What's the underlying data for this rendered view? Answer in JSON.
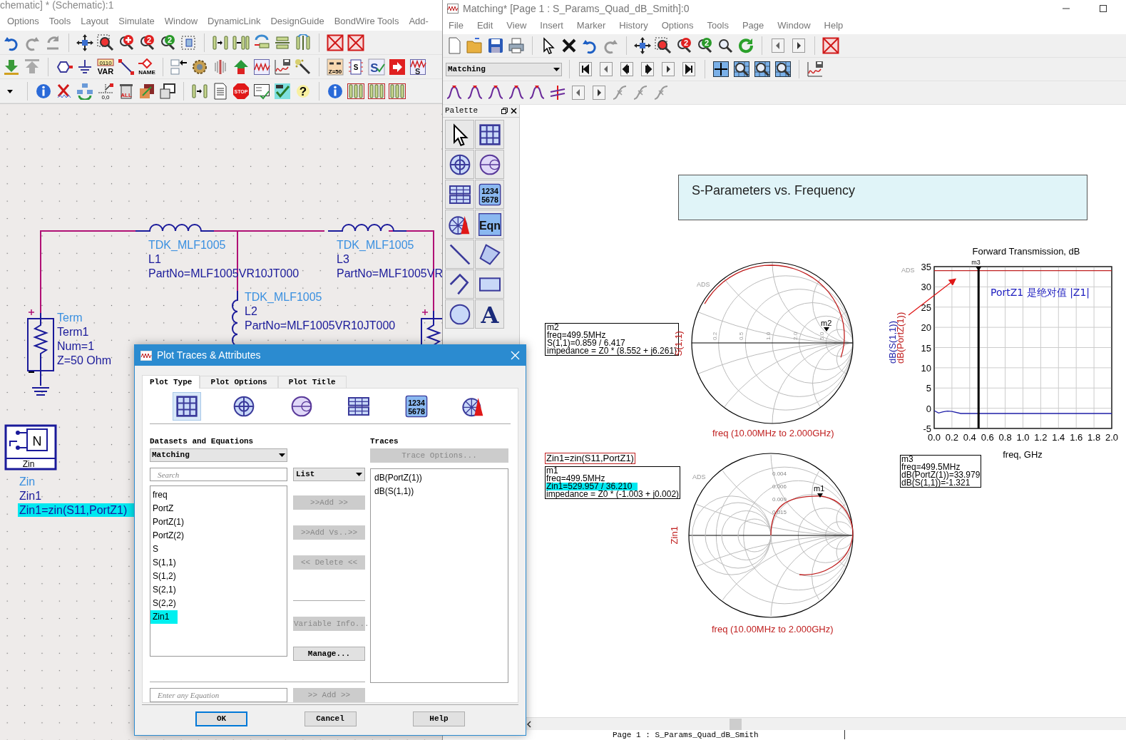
{
  "schematic_window": {
    "title": "chematic] * (Schematic):1",
    "menu": [
      "Options",
      "Tools",
      "Layout",
      "Simulate",
      "Window",
      "DynamicLink",
      "DesignGuide",
      "BondWire Tools",
      "Add-"
    ],
    "toolbars": [
      [
        {
          "kind": "undo"
        },
        {
          "kind": "redo"
        },
        {
          "kind": "rotate"
        },
        {
          "kind": "sep"
        },
        {
          "kind": "move"
        },
        {
          "kind": "zoom-area"
        },
        {
          "kind": "zoom-plus"
        },
        {
          "kind": "zoom-red",
          "label": "2"
        },
        {
          "kind": "zoom-green",
          "label": "2"
        },
        {
          "kind": "snap"
        },
        {
          "kind": "sep"
        },
        {
          "kind": "comp-step"
        },
        {
          "kind": "comp-pair"
        },
        {
          "kind": "swap"
        },
        {
          "kind": "flip"
        },
        {
          "kind": "mirror"
        },
        {
          "kind": "sep"
        },
        {
          "kind": "x-box"
        },
        {
          "kind": "x-box"
        }
      ],
      [
        {
          "kind": "down"
        },
        {
          "kind": "up"
        },
        {
          "kind": "sep"
        },
        {
          "kind": "port"
        },
        {
          "kind": "ground"
        },
        {
          "kind": "var",
          "top_label": "0110",
          "label": "VAR"
        },
        {
          "kind": "wire"
        },
        {
          "kind": "name",
          "label": "NAME"
        },
        {
          "kind": "sep"
        },
        {
          "kind": "sim-in"
        },
        {
          "kind": "gear"
        },
        {
          "kind": "probe"
        },
        {
          "kind": "arrow-up"
        },
        {
          "kind": "chart"
        },
        {
          "kind": "chart-save"
        },
        {
          "kind": "wand"
        },
        {
          "kind": "sep"
        },
        {
          "kind": "z50",
          "label": "Z=50"
        },
        {
          "kind": "s-box",
          "label": "S"
        },
        {
          "kind": "s-check",
          "label": "S"
        },
        {
          "kind": "arrow-box"
        },
        {
          "kind": "s-chart",
          "label": "S"
        }
      ],
      [
        {
          "kind": "caret"
        },
        {
          "kind": "sep"
        },
        {
          "kind": "info"
        },
        {
          "kind": "x-wave"
        },
        {
          "kind": "tree"
        },
        {
          "kind": "origin",
          "label": "0,0"
        },
        {
          "kind": "trash",
          "label": "ALL"
        },
        {
          "kind": "layers"
        },
        {
          "kind": "windows"
        },
        {
          "kind": "sep"
        },
        {
          "kind": "comp-step"
        },
        {
          "kind": "doc"
        },
        {
          "kind": "stop",
          "label": "STOP"
        },
        {
          "kind": "checklist"
        },
        {
          "kind": "check-db"
        },
        {
          "kind": "help",
          "label": "?"
        },
        {
          "kind": "sep"
        },
        {
          "kind": "info"
        },
        {
          "kind": "comp-3"
        },
        {
          "kind": "comp-3"
        },
        {
          "kind": "comp-3"
        }
      ]
    ],
    "components": [
      {
        "kind": "inductor-h",
        "lines": [
          {
            "kind": "model",
            "text": "TDK_MLF1005"
          },
          {
            "kind": "name",
            "text": "L1"
          },
          {
            "kind": "param",
            "text": "PartNo=MLF1005VR10JT000"
          }
        ]
      },
      {
        "kind": "inductor-h",
        "lines": [
          {
            "kind": "model",
            "text": "TDK_MLF1005"
          },
          {
            "kind": "name",
            "text": "L3"
          },
          {
            "kind": "param",
            "text": "PartNo=MLF1005VR"
          }
        ]
      },
      {
        "kind": "inductor-v",
        "lines": [
          {
            "kind": "model",
            "text": "TDK_MLF1005"
          },
          {
            "kind": "name",
            "text": "L2"
          },
          {
            "kind": "param",
            "text": "PartNo=MLF1005VR10JT000"
          }
        ]
      },
      {
        "kind": "term",
        "lines": [
          {
            "kind": "model",
            "text": "Term"
          },
          {
            "kind": "name",
            "text": "Term1"
          },
          {
            "kind": "param",
            "text": "Num=1"
          },
          {
            "kind": "param",
            "text": "Z=50 Ohm"
          }
        ]
      },
      {
        "kind": "term-partial"
      },
      {
        "kind": "zin",
        "symbol_letter": "N",
        "symbol_label": "Zin",
        "lines": [
          {
            "kind": "model",
            "text": "Zin"
          },
          {
            "kind": "name",
            "text": "Zin1"
          },
          {
            "kind": "equation",
            "text": "Zin1=zin(S11,PortZ1)"
          }
        ]
      }
    ]
  },
  "display_window": {
    "title": "Matching* [Page 1 : S_Params_Quad_dB_Smith]:0",
    "menu": [
      "File",
      "Edit",
      "View",
      "Insert",
      "Marker",
      "History",
      "Options",
      "Tools",
      "Page",
      "Window",
      "Help"
    ],
    "toolbars": [
      [
        {
          "kind": "new"
        },
        {
          "kind": "open"
        },
        {
          "kind": "save"
        },
        {
          "kind": "print"
        },
        {
          "kind": "sep"
        },
        {
          "kind": "pointer"
        },
        {
          "kind": "delete"
        },
        {
          "kind": "undo"
        },
        {
          "kind": "redo"
        },
        {
          "kind": "sep"
        },
        {
          "kind": "move"
        },
        {
          "kind": "zoom-area"
        },
        {
          "kind": "zoom-red",
          "label": "2"
        },
        {
          "kind": "zoom-green",
          "label": "2"
        },
        {
          "kind": "zoom"
        },
        {
          "kind": "refresh"
        },
        {
          "kind": "sep"
        },
        {
          "kind": "nav-prev"
        },
        {
          "kind": "nav-next"
        },
        {
          "kind": "sep"
        },
        {
          "kind": "x-box"
        }
      ],
      [
        {
          "kind": "dropdown",
          "label": "Matching"
        },
        {
          "kind": "sep"
        },
        {
          "kind": "nav-first"
        },
        {
          "kind": "nav-prev"
        },
        {
          "kind": "step-back"
        },
        {
          "kind": "step-fwd"
        },
        {
          "kind": "nav-next"
        },
        {
          "kind": "nav-last"
        },
        {
          "kind": "sep"
        },
        {
          "kind": "fit-grid"
        },
        {
          "kind": "zoom-grid"
        },
        {
          "kind": "zoom-grid"
        },
        {
          "kind": "zoom-grid"
        },
        {
          "kind": "sep"
        },
        {
          "kind": "chart-save"
        }
      ],
      [
        {
          "kind": "marker"
        },
        {
          "kind": "marker"
        },
        {
          "kind": "marker"
        },
        {
          "kind": "marker"
        },
        {
          "kind": "marker"
        },
        {
          "kind": "delta"
        },
        {
          "kind": "nav-prev"
        },
        {
          "kind": "nav-next"
        },
        {
          "kind": "trace"
        },
        {
          "kind": "trace"
        },
        {
          "kind": "trace"
        }
      ]
    ],
    "palette": {
      "title": "Palette",
      "tools": [
        {
          "kind": "pointer"
        },
        {
          "kind": "grid"
        },
        {
          "kind": "polar"
        },
        {
          "kind": "smith"
        },
        {
          "kind": "table"
        },
        {
          "kind": "numbers",
          "label": "1234 5678"
        },
        {
          "kind": "polar-antenna"
        },
        {
          "kind": "eqn",
          "label": "Eqn"
        },
        {
          "kind": "line"
        },
        {
          "kind": "polygon"
        },
        {
          "kind": "polyline"
        },
        {
          "kind": "rect"
        },
        {
          "kind": "circle"
        },
        {
          "kind": "text-a",
          "label": "A"
        }
      ]
    },
    "page_title": "S-Parameters vs. Frequency",
    "smith_top": {
      "logo": "ADS",
      "axis_label": "S(1,1)",
      "freq_label": "freq (10.00MHz to 2.000GHz)",
      "scale_labels": [
        "0.2",
        "0.5",
        "1.0",
        "2.0",
        "5.0"
      ],
      "marker": "m2",
      "marker_box": [
        "m2",
        "freq=499.5MHz",
        "S(1,1)=0.859 / 6.417",
        "impedance = Z0 * (8.552 + j6.261)"
      ]
    },
    "smith_bottom": {
      "logo": "ADS",
      "equation": "Zin1=zin(S11,PortZ1)",
      "axis_label": "Zin1",
      "freq_label": "freq (10.00MHz to 2.000GHz)",
      "scale_labels": [
        "0.004",
        "0.006",
        "0.009",
        "0.015"
      ],
      "marker": "m1",
      "marker_box": [
        {
          "text": "m1",
          "highlighted": false
        },
        {
          "text": "freq=499.5MHz",
          "highlighted": false
        },
        {
          "text": "Zin1=529.957 / 36.210",
          "highlighted": true
        },
        {
          "text": "impedance = Z0 * (-1.003 + j0.002)",
          "highlighted": false
        }
      ]
    },
    "rect_plot": {
      "logo": "ADS",
      "marker_box": [
        "m3",
        "freq=499.5MHz",
        "dB(PortZ(1))=33.979",
        "dB(S(1,1))=-1.321"
      ],
      "chart_data": {
        "type": "line",
        "title": "Forward Transmission, dB",
        "xlabel": "freq, GHz",
        "x": [
          0,
          0.05,
          0.1,
          0.15,
          0.2,
          0.3,
          0.5,
          1.0,
          1.5,
          2.0
        ],
        "series": [
          {
            "name": "dB(S(1,1))",
            "color": "#1f1fa8",
            "values": [
              -0.6,
              -1.2,
              -0.9,
              -0.7,
              -0.8,
              -1.3,
              -1.3,
              -1.3,
              -1.3,
              -1.3
            ]
          },
          {
            "name": "dB(PortZ(1))",
            "color": "#c02020",
            "values": [
              34,
              34,
              34,
              34,
              34,
              34,
              34,
              34,
              34,
              34
            ]
          }
        ],
        "xlim": [
          0,
          2
        ],
        "ylim": [
          -5,
          35
        ],
        "xticks": [
          {
            "value": 0,
            "label": "0.0"
          },
          {
            "value": 0.2,
            "label": "0.2"
          },
          {
            "value": 0.4,
            "label": "0.4"
          },
          {
            "value": 0.6,
            "label": "0.6"
          },
          {
            "value": 0.8,
            "label": "0.8"
          },
          {
            "value": 1,
            "label": "1.0"
          },
          {
            "value": 1.2,
            "label": "1.2"
          },
          {
            "value": 1.4,
            "label": "1.4"
          },
          {
            "value": 1.6,
            "label": "1.6"
          },
          {
            "value": 1.8,
            "label": "1.8"
          },
          {
            "value": 2,
            "label": "2.0"
          }
        ],
        "yticks": [
          -5,
          0,
          5,
          10,
          15,
          20,
          25,
          30,
          35
        ],
        "grid": true,
        "ref_lines": [
          {
            "axis": "x",
            "value": 0.5,
            "label": "m3"
          }
        ],
        "annotations": [
          {
            "text": "PortZ1 是绝对值 |Z1|"
          }
        ]
      }
    },
    "page_tab": "Page 1 : S_Params_Quad_dB_Smith"
  },
  "dialog": {
    "title": "Plot Traces & Attributes",
    "tabs": [
      {
        "label": "Plot Type",
        "selected": true
      },
      {
        "label": "Plot Options",
        "selected": false
      },
      {
        "label": "Plot Title",
        "selected": false
      }
    ],
    "plot_types": [
      {
        "kind": "grid",
        "selected": true
      },
      {
        "kind": "polar",
        "selected": false
      },
      {
        "kind": "smith",
        "selected": false
      },
      {
        "kind": "table",
        "selected": false
      },
      {
        "kind": "numbers",
        "label": "1234 5678",
        "selected": false
      },
      {
        "kind": "polar-antenna",
        "selected": false
      }
    ],
    "datasets_label": "Datasets and Equations",
    "dataset": "Matching",
    "search_placeholder": "Search",
    "view_mode": "List",
    "variables": [
      {
        "label": "freq",
        "selected": false
      },
      {
        "label": "PortZ",
        "selected": false
      },
      {
        "label": "PortZ(1)",
        "selected": false
      },
      {
        "label": "PortZ(2)",
        "selected": false
      },
      {
        "label": "S",
        "selected": false
      },
      {
        "label": "S(1,1)",
        "selected": false
      },
      {
        "label": "S(1,2)",
        "selected": false
      },
      {
        "label": "S(2,1)",
        "selected": false
      },
      {
        "label": "S(2,2)",
        "selected": false
      },
      {
        "label": "Zin1",
        "selected": true
      }
    ],
    "middle_buttons": [
      {
        "label": ">>Add >>",
        "disabled": true
      },
      {
        "label": ">>Add Vs..>>",
        "disabled": true
      },
      {
        "label": "<< Delete <<",
        "disabled": true
      },
      {
        "kind": "divider"
      },
      {
        "label": "Variable Info...",
        "disabled": true
      },
      {
        "label": "Manage...",
        "disabled": false
      }
    ],
    "equation_placeholder": "Enter any Equation",
    "equation_add": {
      "label": ">> Add >>",
      "disabled": true
    },
    "traces_label": "Traces",
    "trace_options": {
      "label": "Trace Options...",
      "disabled": true
    },
    "traces": [
      "dB(PortZ(1))",
      "dB(S(1,1))"
    ],
    "buttons": [
      {
        "label": "OK",
        "default": true
      },
      {
        "label": "Cancel",
        "default": false
      },
      {
        "label": "Help",
        "default": false
      }
    ]
  }
}
